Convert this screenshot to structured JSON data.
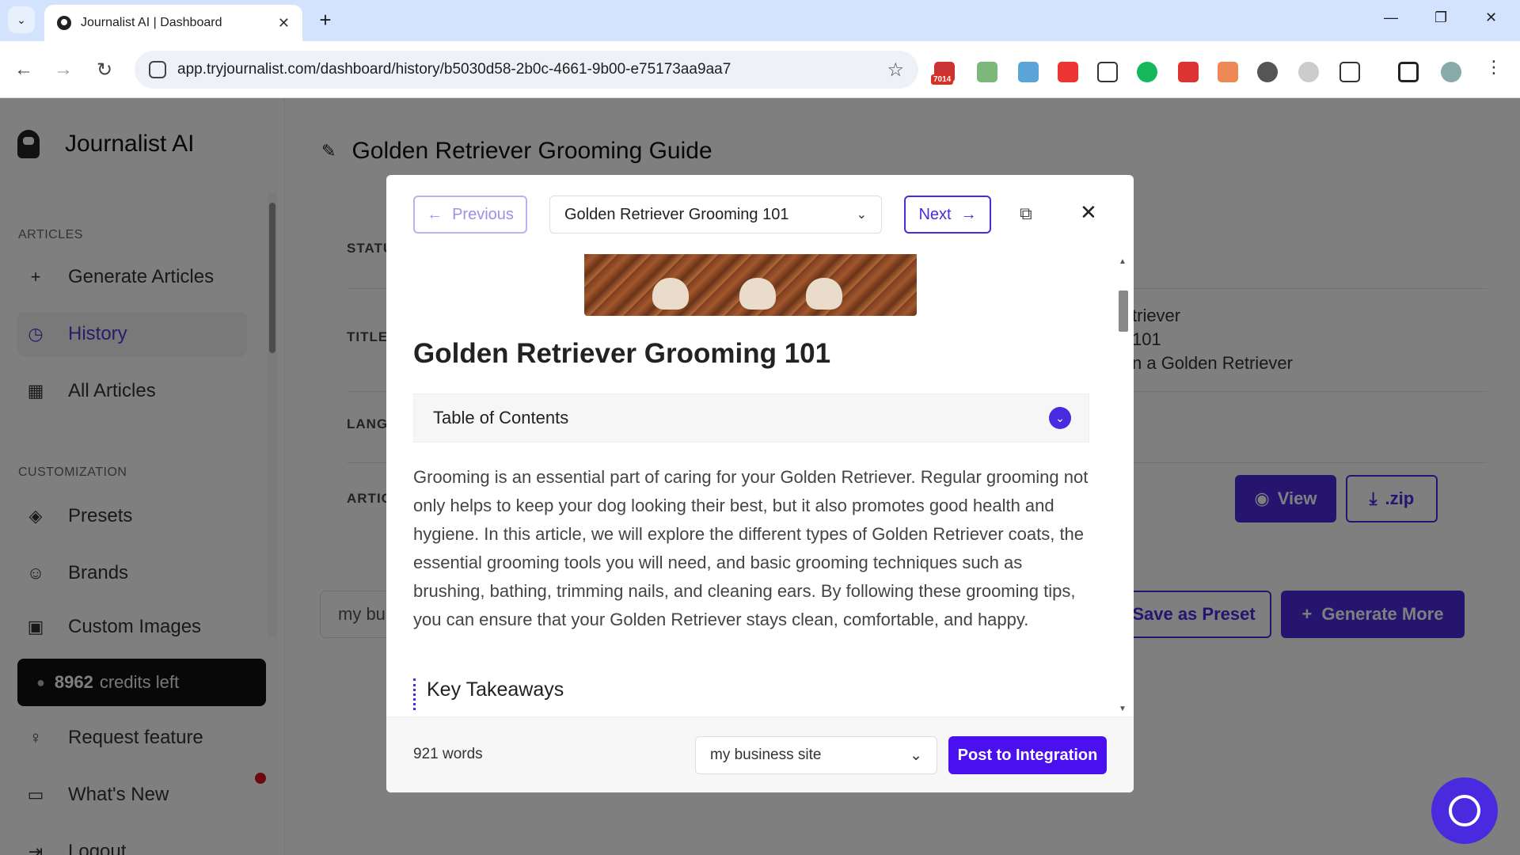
{
  "browser": {
    "tab_title": "Journalist AI | Dashboard",
    "url": "app.tryjournalist.com/dashboard/history/b5030d58-2b0c-4661-9b00-e75173aa9aa7",
    "ext_badge": "7014",
    "icons": {
      "tab_list": "chevron-down-icon",
      "new_tab": "plus-icon",
      "back": "arrow-left-icon",
      "forward": "arrow-right-icon",
      "reload": "reload-icon",
      "bookmark": "star-icon"
    }
  },
  "sidebar": {
    "brand": "Journalist AI",
    "sections": {
      "articles": "ARTICLES",
      "customization": "CUSTOMIZATION"
    },
    "items": [
      {
        "label": "Generate Articles",
        "icon": "plus-icon"
      },
      {
        "label": "History",
        "icon": "clock-icon"
      },
      {
        "label": "All Articles",
        "icon": "grid-icon"
      },
      {
        "label": "Presets",
        "icon": "layers-icon"
      },
      {
        "label": "Brands",
        "icon": "smile-icon"
      },
      {
        "label": "Custom Images",
        "icon": "image-icon"
      },
      {
        "label": "Request feature",
        "icon": "lightbulb-icon"
      },
      {
        "label": "What's New",
        "icon": "inbox-icon"
      },
      {
        "label": "Logout",
        "icon": "logout-icon"
      }
    ],
    "credits": {
      "count": "8962",
      "text": "credits left"
    }
  },
  "main": {
    "title": "Golden Retriever Grooming Guide",
    "labels": {
      "status": "STATU",
      "title": "TITLE",
      "language": "LANG",
      "articles": "ARTIC"
    },
    "title_lines": [
      "triever",
      "101",
      "n a Golden Retriever"
    ],
    "view_label": "View",
    "zip_label": ".zip",
    "input_value": "my bu",
    "save_preset_label": "Save as Preset",
    "generate_more_label": "Generate More"
  },
  "modal": {
    "previous_label": "Previous",
    "article_select": "Golden Retriever Grooming 101",
    "next_label": "Next",
    "heading": "Golden Retriever Grooming 101",
    "toc_label": "Table of Contents",
    "paragraph": "Grooming is an essential part of caring for your Golden Retriever. Regular grooming not only helps to keep your dog looking their best, but it also promotes good health and hygiene. In this article, we will explore the different types of Golden Retriever coats, the essential grooming tools you will need, and basic grooming techniques such as brushing, bathing, trimming nails, and cleaning ears. By following these grooming tips, you can ensure that your Golden Retriever stays clean, comfortable, and happy.",
    "key_takeaways": "Key Takeaways",
    "word_count": "921 words",
    "integration_select": "my business site",
    "post_label": "Post to Integration"
  },
  "colors": {
    "accent": "#4a2adf",
    "post_button": "#4a10ef",
    "tabstrip": "#d3e3fd",
    "notification_dot": "#d8121a"
  }
}
